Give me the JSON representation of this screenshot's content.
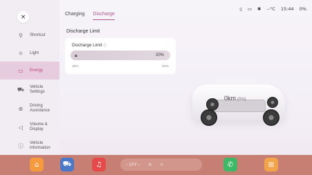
{
  "sidebar": {
    "close_glyph": "×",
    "items": [
      {
        "label": "Shortcut",
        "icon": "link-icon"
      },
      {
        "label": "Light",
        "icon": "sun-icon"
      },
      {
        "label": "Energy",
        "icon": "battery-icon"
      },
      {
        "label": "Vehicle Settings",
        "icon": "car-icon"
      },
      {
        "label": "Driving Assistance",
        "icon": "steering-wheel-icon"
      },
      {
        "label": "Volume & Display",
        "icon": "speaker-icon"
      },
      {
        "label": "Vehicle information",
        "icon": "info-icon"
      }
    ]
  },
  "tabs": [
    {
      "label": "Charging"
    },
    {
      "label": "Discharge"
    }
  ],
  "status": {
    "temperature": "--°C",
    "time": "15:44",
    "battery": "0%"
  },
  "main": {
    "section_title": "Discharge Limit",
    "card_label": "Discharge Limit",
    "limit_value": "20%",
    "limit_fraction": 0.0,
    "min_label": "20%",
    "max_label": "50%"
  },
  "car": {
    "range": "0km",
    "range_pct": "(0%)"
  },
  "dock": {
    "climate_off": "‹ OFF ›"
  },
  "colors": {
    "accent": "#c2407f",
    "dock": "#c87f73"
  }
}
